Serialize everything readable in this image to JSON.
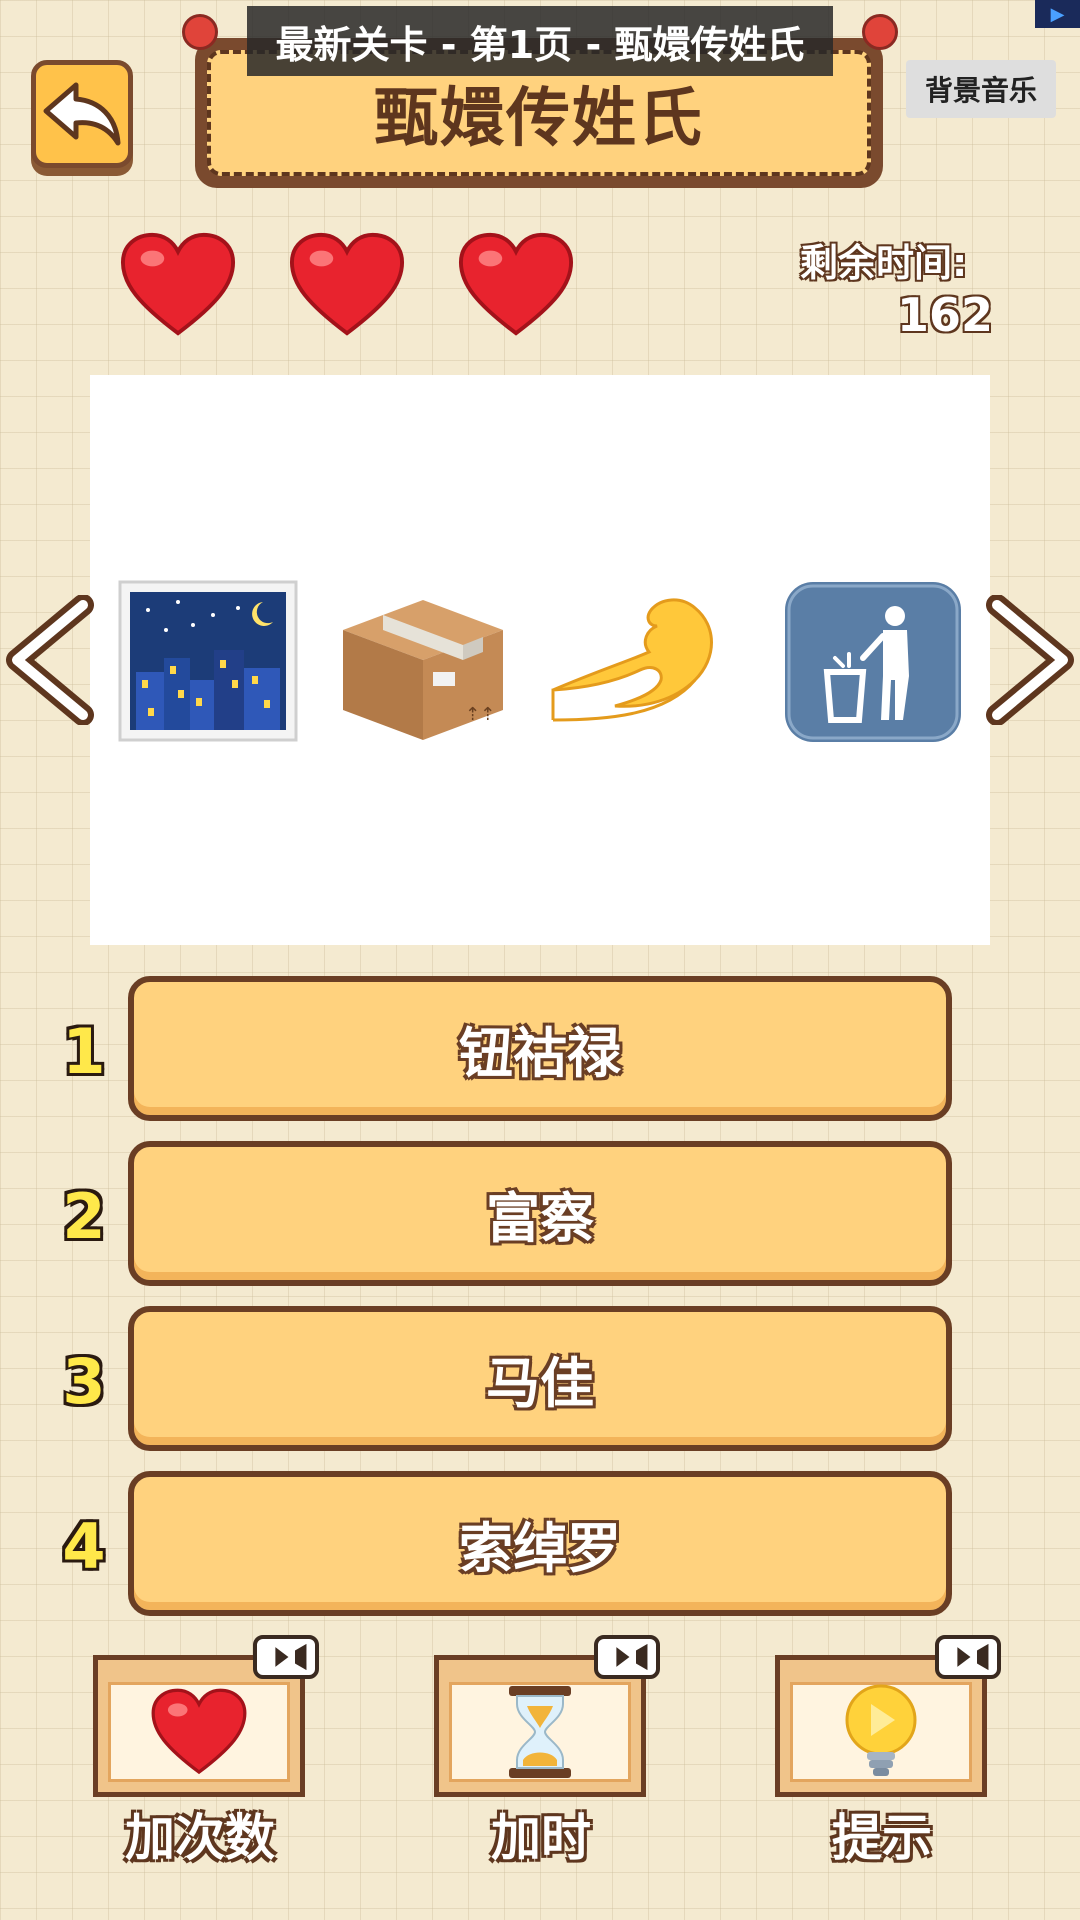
{
  "header": {
    "breadcrumb": "最新关卡 - 第1页 - 甄嬛传姓氏",
    "title": "甄嬛传姓氏",
    "music_button": "背景音乐"
  },
  "status": {
    "lives": 3,
    "time_label": "剩余时间:",
    "time_value": "162"
  },
  "puzzle": {
    "emojis": [
      "night-city-icon",
      "package-box-icon",
      "pinched-fingers-icon",
      "trash-can-icon"
    ]
  },
  "options": [
    {
      "number": "1",
      "label": "钮祜禄"
    },
    {
      "number": "2",
      "label": "富察"
    },
    {
      "number": "3",
      "label": "马佳"
    },
    {
      "number": "4",
      "label": "索绰罗"
    }
  ],
  "powerups": [
    {
      "label": "加次数",
      "icon": "heart-icon"
    },
    {
      "label": "加时",
      "icon": "hourglass-icon"
    },
    {
      "label": "提示",
      "icon": "lightbulb-icon"
    }
  ],
  "colors": {
    "accent": "#ffd27e",
    "border": "#6a3e24",
    "heart": "#e8232e"
  }
}
